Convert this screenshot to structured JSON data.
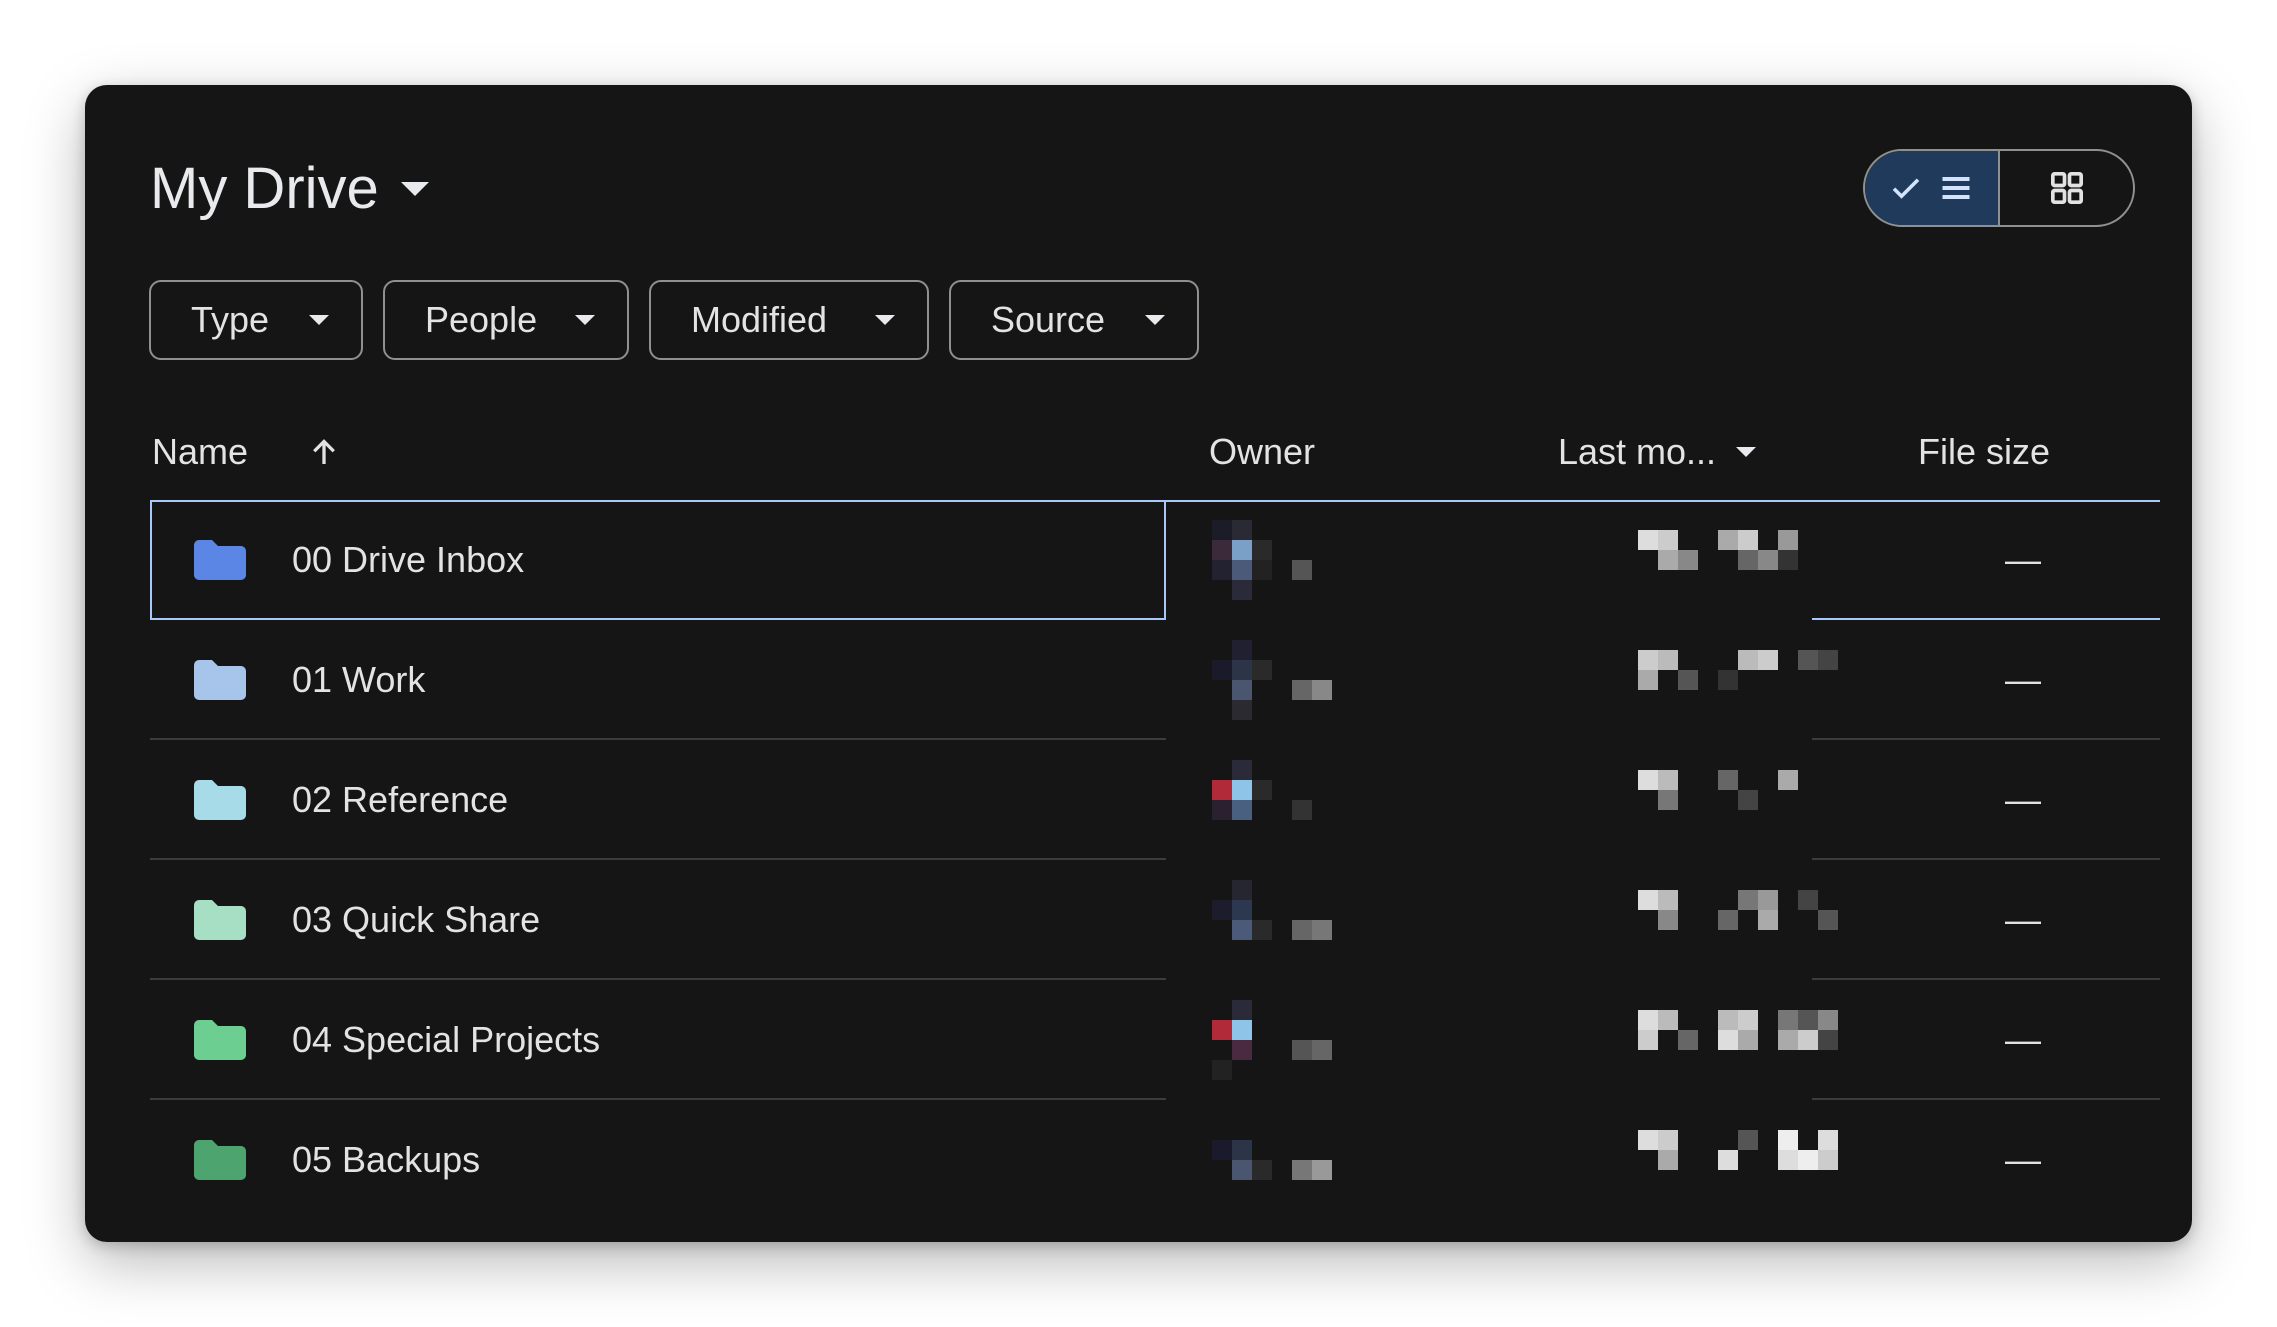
{
  "title": "My Drive",
  "view_toggle": {
    "list_icon": "list-icon",
    "grid_icon": "grid-icon",
    "active": "list"
  },
  "filters": [
    "Type",
    "People",
    "Modified",
    "Source"
  ],
  "columns": {
    "name": "Name",
    "owner": "Owner",
    "last_modified": "Last mo...",
    "file_size": "File size"
  },
  "rows": [
    {
      "name": "00 Drive Inbox",
      "size": "—",
      "folder_color": "#5b86e5"
    },
    {
      "name": "01 Work",
      "size": "—",
      "folder_color": "#a7c5ea"
    },
    {
      "name": "02 Reference",
      "size": "—",
      "folder_color": "#a8dbe8"
    },
    {
      "name": "03 Quick Share",
      "size": "—",
      "folder_color": "#a6dfc4"
    },
    {
      "name": "04 Special Projects",
      "size": "—",
      "folder_color": "#6ccf91"
    },
    {
      "name": "05 Backups",
      "size": "—",
      "folder_color": "#4da46f"
    }
  ],
  "colors": {
    "background": "#151515",
    "text": "#e3e3e3",
    "accent": "#a8c7fa",
    "toggle_active": "#1f3a5a"
  }
}
